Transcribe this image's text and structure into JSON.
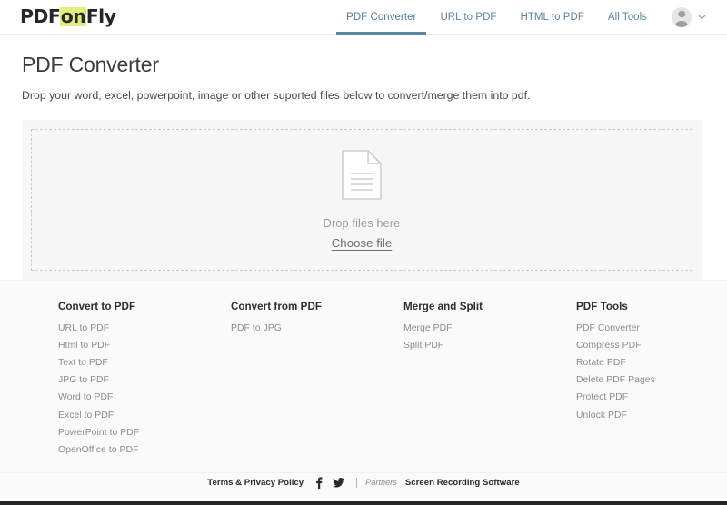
{
  "header": {
    "logo": {
      "part1": "PDF",
      "part2": "on",
      "part3": "Fly",
      "highlight_color": "#e3ec7e"
    },
    "nav": [
      {
        "label": "PDF Converter",
        "active": true
      },
      {
        "label": "URL to PDF",
        "active": false
      },
      {
        "label": "HTML to PDF",
        "active": false
      },
      {
        "label": "All Tools",
        "active": false
      }
    ],
    "accent_color": "#5b87a3",
    "avatar_icon": "user-avatar-icon",
    "chevron_icon": "chevron-down-icon"
  },
  "main": {
    "title": "PDF Converter",
    "subtitle": "Drop your word, excel, powerpoint, image or other suported files below to convert/merge them into pdf.",
    "dropzone": {
      "file_icon": "document-file-icon",
      "drop_text": "Drop files here",
      "choose_label": "Choose file"
    }
  },
  "footer": {
    "columns": [
      {
        "heading": "Convert to PDF",
        "links": [
          "URL to PDF",
          "Html to PDF",
          "Text to PDF",
          "JPG to PDF",
          "Word to PDF",
          "Excel to PDF",
          "PowerPoint to PDF",
          "OpenOffice to PDF"
        ]
      },
      {
        "heading": "Convert from PDF",
        "links": [
          "PDF to JPG"
        ]
      },
      {
        "heading": "Merge and Split",
        "links": [
          "Merge PDF",
          "Split PDF"
        ]
      },
      {
        "heading": "PDF Tools",
        "links": [
          "PDF Converter",
          "Compress PDF",
          "Rotate PDF",
          "Delete PDF Pages",
          "Protect PDF",
          "Unlock PDF"
        ]
      }
    ],
    "bottom_bar": {
      "terms_label": "Terms & Privacy Policy",
      "facebook_icon": "facebook-icon",
      "twitter_icon": "twitter-icon",
      "partners_label": "Partners",
      "partner_link": "Screen Recording Software"
    }
  }
}
